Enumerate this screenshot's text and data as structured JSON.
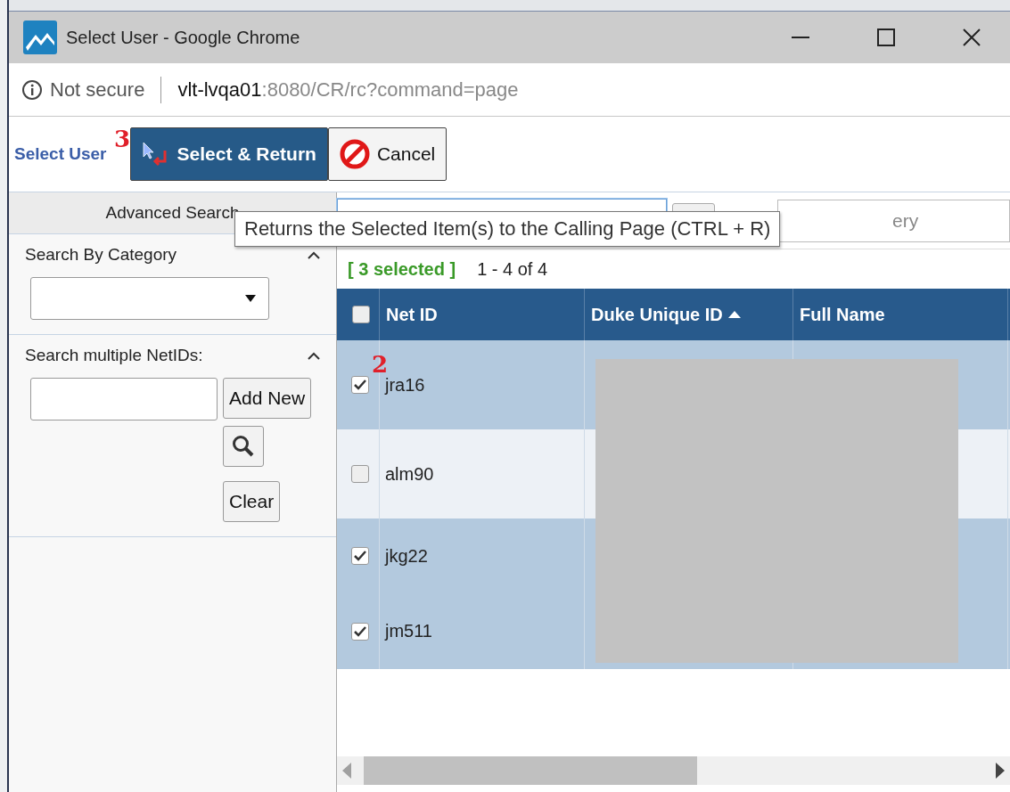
{
  "window": {
    "title": "Select User - Google Chrome"
  },
  "address_bar": {
    "security": "Not secure",
    "host": "vlt-lvqa01",
    "path": ":8080/CR/rc?command=page"
  },
  "toolbar": {
    "title": "Select User",
    "marker": "3",
    "buttons": [
      {
        "label": "Select & Return",
        "kind": "primary"
      },
      {
        "label": "Cancel",
        "kind": "cancel"
      }
    ]
  },
  "tooltip": "Returns the Selected Item(s) to the Calling Page (CTRL + R)",
  "sidebar": {
    "tab": "Advanced Search",
    "sections": [
      {
        "title": "Search By Category",
        "kind": "select",
        "expanded": true
      },
      {
        "title": "Search multiple NetIDs:",
        "kind": "netids",
        "expanded": true,
        "buttons": [
          "Add New",
          "Clear"
        ]
      }
    ]
  },
  "search": {
    "placeholder": "ery"
  },
  "grid": {
    "selection": "[ 3 selected ]",
    "range": "1 - 4 of 4",
    "all_checked": false,
    "columns": [
      {
        "label": "Net ID",
        "sorted": false
      },
      {
        "label": "Duke Unique ID",
        "sorted": true
      },
      {
        "label": "Full Name",
        "sorted": false
      }
    ],
    "rows": [
      {
        "net_id": "jra16",
        "selected": true,
        "marker": "2"
      },
      {
        "net_id": "alm90",
        "selected": false
      },
      {
        "net_id": "jkg22",
        "selected": true
      },
      {
        "net_id": "jm511",
        "selected": true
      }
    ]
  }
}
